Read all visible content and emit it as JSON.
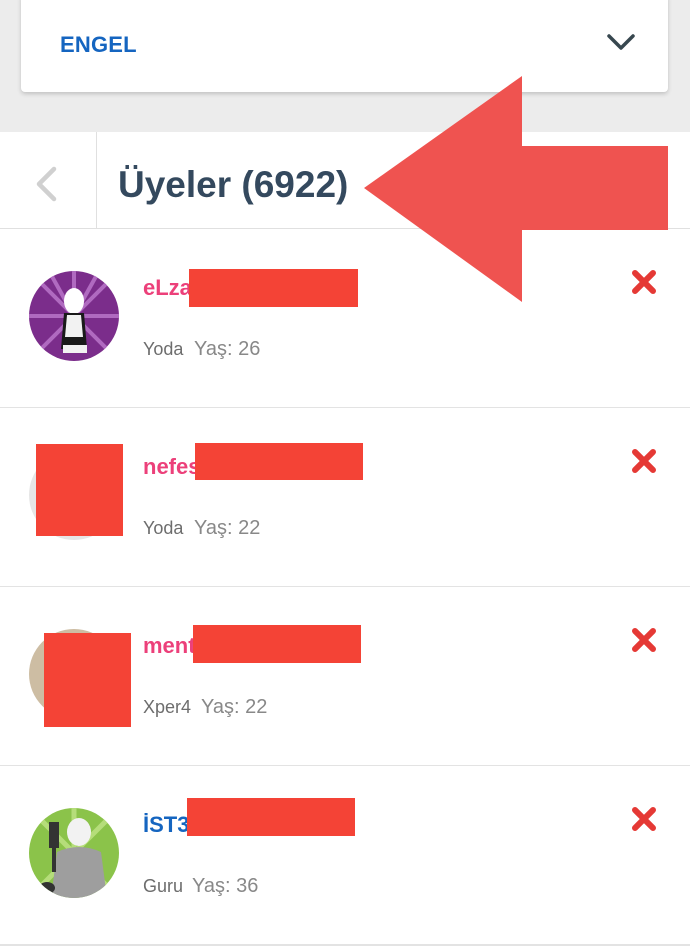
{
  "dropdown": {
    "label": "ENGEL"
  },
  "header": {
    "title": "Üyeler (6922)"
  },
  "members": [
    {
      "name": "eLza",
      "rank": "Yoda",
      "age": "Yaş: 26"
    },
    {
      "name": "nefes",
      "rank": "Yoda",
      "age": "Yaş: 22"
    },
    {
      "name": "ment",
      "rank": "Xper4",
      "age": "Yaş: 22"
    },
    {
      "name": "İST3",
      "rank": "Guru",
      "age": "Yaş: 36"
    }
  ],
  "colors": {
    "accent_blue": "#1565c0",
    "name_pink": "#ec407a",
    "remove_red": "#e53935",
    "redaction_red": "#f44336",
    "annotation_arrow": "#ef5350"
  },
  "icons": {
    "dropdown": "chevron-down-icon",
    "back": "chevron-left-icon",
    "remove": "close-x-icon",
    "annotation": "arrow-left-icon"
  }
}
